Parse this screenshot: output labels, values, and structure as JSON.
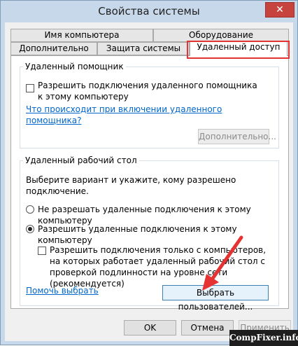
{
  "window": {
    "title": "Свойства системы",
    "close_glyph": "✕"
  },
  "tabs": {
    "computer_name": "Имя компьютера",
    "hardware": "Оборудование",
    "advanced": "Дополнительно",
    "protection": "Защита системы",
    "remote": "Удаленный доступ"
  },
  "remote_assistance": {
    "group_label": "Удаленный помощник",
    "checkbox_label": "Разрешить подключения удаленного помощника к этому компьютеру",
    "checkbox_checked": false,
    "help_link": "Что происходит при включении удаленного помощника?",
    "advanced_button": "Дополнительно..."
  },
  "remote_desktop": {
    "group_label": "Удаленный рабочий стол",
    "prompt": "Выберите вариант и укажите, кому разрешено подключение.",
    "option_deny": "Не разрешать удаленные подключения к этому компьютеру",
    "option_allow": "Разрешить удаленные подключения к этому компьютеру",
    "selected": "allow",
    "nla_checkbox_label": "Разрешить подключения только с компьютеров, на которых работает удаленный рабочий стол с проверкой подлинности на уровне сети (рекомендуется)",
    "nla_checked": false,
    "help_link": "Помочь выбрать",
    "select_users_button": "Выбрать пользователей..."
  },
  "footer": {
    "ok": "OK",
    "cancel": "Отмена",
    "apply": "Применить"
  },
  "watermark": "CompFixer.info",
  "colors": {
    "highlight": "#e53232",
    "link": "#0066cc",
    "close": "#c7433d"
  }
}
